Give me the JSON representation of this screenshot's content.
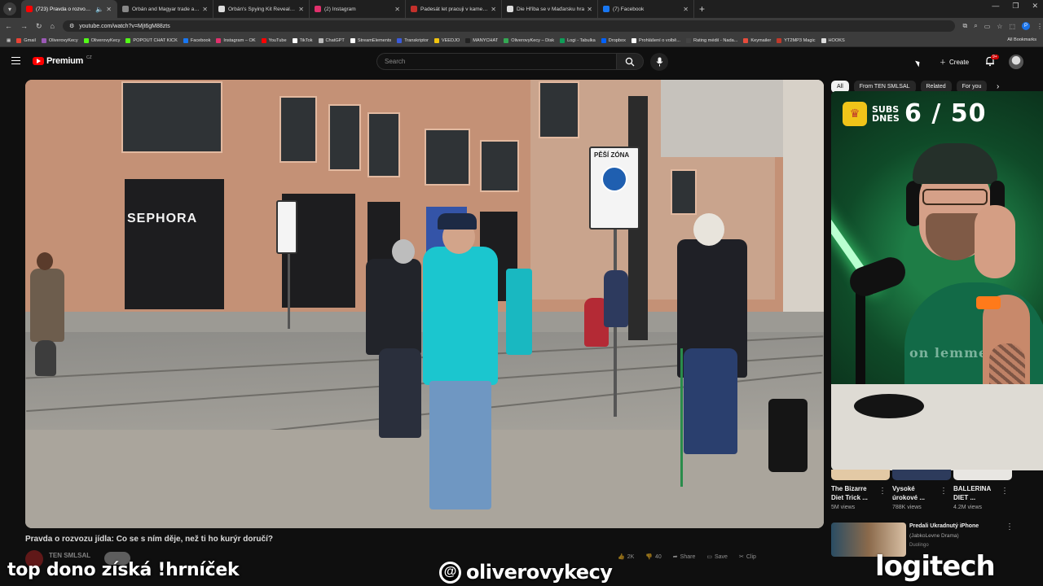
{
  "browser": {
    "tabs": [
      {
        "title": "(723) Pravda o rozvozu jídla",
        "color": "#ff0000",
        "active": true
      },
      {
        "title": "Orbán and Magyar trade accus",
        "color": "#888888",
        "active": false
      },
      {
        "title": "Orbán's Spying Kit Revealed: Is",
        "color": "#dddddd",
        "active": false
      },
      {
        "title": "(2) Instagram",
        "color": "#e1306c",
        "active": false
      },
      {
        "title": "Padesát let pracuji v kamenolo",
        "color": "#c4302b",
        "active": false
      },
      {
        "title": "Die Hříba se v Maďarsku hra",
        "color": "#dddddd",
        "active": false
      },
      {
        "title": "(7) Facebook",
        "color": "#1877f2",
        "active": false
      }
    ],
    "url": "youtube.com/watch?v=Mjt6gM88zts",
    "profile_initial": "P",
    "bookmarks": [
      {
        "label": "Gmail",
        "color": "#ea4335"
      },
      {
        "label": "OliverovyKecy",
        "color": "#9b59b6"
      },
      {
        "label": "OliverovyKecy",
        "color": "#53fc18"
      },
      {
        "label": "POPOUT CHAT KICK",
        "color": "#53fc18"
      },
      {
        "label": "Facebook",
        "color": "#1877f2"
      },
      {
        "label": "Instagram – OK",
        "color": "#e1306c"
      },
      {
        "label": "YouTube",
        "color": "#ff0000"
      },
      {
        "label": "TikTok",
        "color": "#ffffff"
      },
      {
        "label": "ChatGPT",
        "color": "#bbbbbb"
      },
      {
        "label": "StreamElements",
        "color": "#ffffff"
      },
      {
        "label": "Transkriptor",
        "color": "#3b5bdb"
      },
      {
        "label": "VEEDJO",
        "color": "#f1c40f"
      },
      {
        "label": "MANYCHAT",
        "color": "#222222"
      },
      {
        "label": "OliverovyKecy – Disk",
        "color": "#34a853"
      },
      {
        "label": "Logi - Tabulka",
        "color": "#0f9d58"
      },
      {
        "label": "Dropbox",
        "color": "#0061ff"
      },
      {
        "label": "Prohlášení o volbě...",
        "color": "#ffffff"
      },
      {
        "label": "Rating médií - Nada...",
        "color": "#444444"
      },
      {
        "label": "Keymailer",
        "color": "#e74c3c"
      },
      {
        "label": "YT2MP3 Magic",
        "color": "#c0392b"
      },
      {
        "label": "HOOKS",
        "color": "#dddddd"
      }
    ],
    "all_bookmarks": "All Bookmarks"
  },
  "youtube": {
    "logo_word": "Premium",
    "country": "CZ",
    "search_placeholder": "Search",
    "create_label": "Create",
    "notif_count": "9+",
    "chips": [
      "All",
      "From TEN SMLSAL",
      "Related",
      "For you"
    ],
    "video_title": "Pravda o rozvozu jídla: Co se s ním děje, než ti ho kurýr doručí?",
    "channel": "TEN SMLSAL",
    "actions": [
      "2K",
      "40",
      "Share",
      "Save",
      "Clip"
    ],
    "sign_text": "PĚŠÍ ZÓNA",
    "shop_sign": "SEPHORA",
    "recs": [
      {
        "title1": "The Bizarre",
        "title2": "Diet Trick ...",
        "views": "5M views"
      },
      {
        "title1": "Vysoké",
        "title2": "úrokové ...",
        "views": "788K views"
      },
      {
        "title1": "BALLERINA",
        "title2": "DIET ...",
        "views": "4.2M views"
      }
    ],
    "rec_list": {
      "title": "Predali Ukradnutý iPhone",
      "channel": "(JabkoLevne Drama)",
      "meta": "Duolingo"
    }
  },
  "stream_overlay": {
    "subs_label": "SUBS DNES",
    "subs_count": "6 / 50",
    "shirt_text": "on lemme",
    "bottom_text": "top dono získá !hrníček",
    "threads_handle": "oliverovykecy",
    "sponsor": "logitech"
  },
  "colors": {
    "yt_red": "#ff0000",
    "accent_chip": "#f1f1f1",
    "background": "#0f0f0f"
  }
}
